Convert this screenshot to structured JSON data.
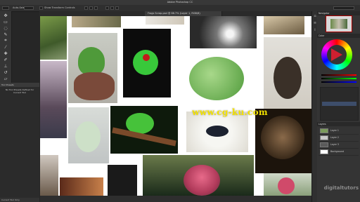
{
  "app": {
    "window_title": "Adobe Photoshop CC"
  },
  "options_bar": {
    "auto_select_label": "Auto-Select:",
    "show_transform_label": "Show Transform Controls"
  },
  "document": {
    "tab_label": "Frogs Scrap.psd @ 66.7% (Layer 1, RGB/8)"
  },
  "left_panel": {
    "header": "Tool Presets",
    "message": "No Tool Presets Defined for Current Tool",
    "footer_label": "Current Tool Only"
  },
  "right_panel": {
    "navigator_header": "Navigator",
    "color_header": "Color",
    "layers_header": "Layers",
    "layers": [
      "Layer 1",
      "Layer 2",
      "Layer 3",
      "Background"
    ]
  },
  "watermark": "www.cg-ku.com",
  "brand_watermark": "digitaltutors",
  "colors": {
    "canvas_bg": "#ffffff",
    "ui_dark": "#262626",
    "watermark_yellow": "#f4e200"
  },
  "icons": [
    "move-icon",
    "marquee-icon",
    "lasso-icon",
    "quick-select-icon",
    "crop-icon",
    "eyedropper-icon",
    "healing-icon",
    "brush-icon",
    "stamp-icon",
    "history-brush-icon",
    "eraser-icon",
    "gradient-icon",
    "blur-icon",
    "dodge-icon",
    "pen-icon",
    "type-icon",
    "path-select-icon",
    "shape-icon",
    "hand-icon",
    "zoom-icon"
  ]
}
